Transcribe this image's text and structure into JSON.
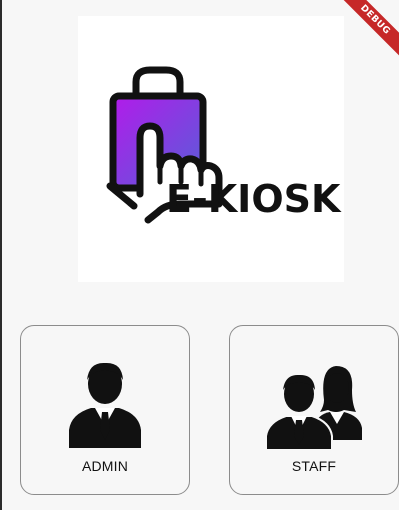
{
  "debug_banner": "DEBUG",
  "logo": {
    "text": "E-KIOSK",
    "gradient_start": "#a020f0",
    "gradient_end": "#5a4fcf"
  },
  "roles": [
    {
      "label": "ADMIN",
      "icon": "businessman-icon"
    },
    {
      "label": "STAFF",
      "icon": "staff-group-icon"
    }
  ],
  "colors": {
    "background": "#f7f7f7",
    "card_border": "#8c8c8c",
    "icon": "#111111",
    "debug": "#c62828"
  }
}
